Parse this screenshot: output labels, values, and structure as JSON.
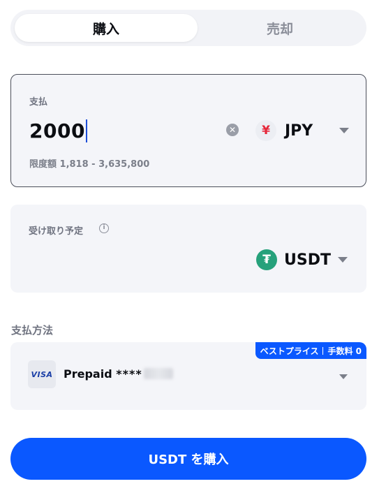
{
  "tabs": {
    "buy": "購入",
    "sell": "売却",
    "active": "buy"
  },
  "pay": {
    "label": "支払",
    "amount": "2000",
    "currency_symbol": "¥",
    "currency_code": "JPY",
    "limit": "限度額 1,818 - 3,635,800"
  },
  "receive": {
    "label": "受け取り予定",
    "currency_symbol": "₮",
    "currency_code": "USDT"
  },
  "payment_method": {
    "title": "支払方法",
    "badge_left": "ベストプライス",
    "badge_right": "手数料 0",
    "card_brand": "VISA",
    "card_name": "Prepaid",
    "card_mask": "****"
  },
  "buy_button": "USDT を購入",
  "colors": {
    "accent": "#0a58ff",
    "tether": "#26a17b",
    "yen": "#e5273a",
    "card_bg": "#f4f5f9"
  },
  "icons": {
    "clear": "clear-icon",
    "info": "info-icon",
    "dropdown": "chevron-down-icon",
    "yen": "yen-icon",
    "tether": "tether-icon",
    "visa": "visa-logo"
  }
}
